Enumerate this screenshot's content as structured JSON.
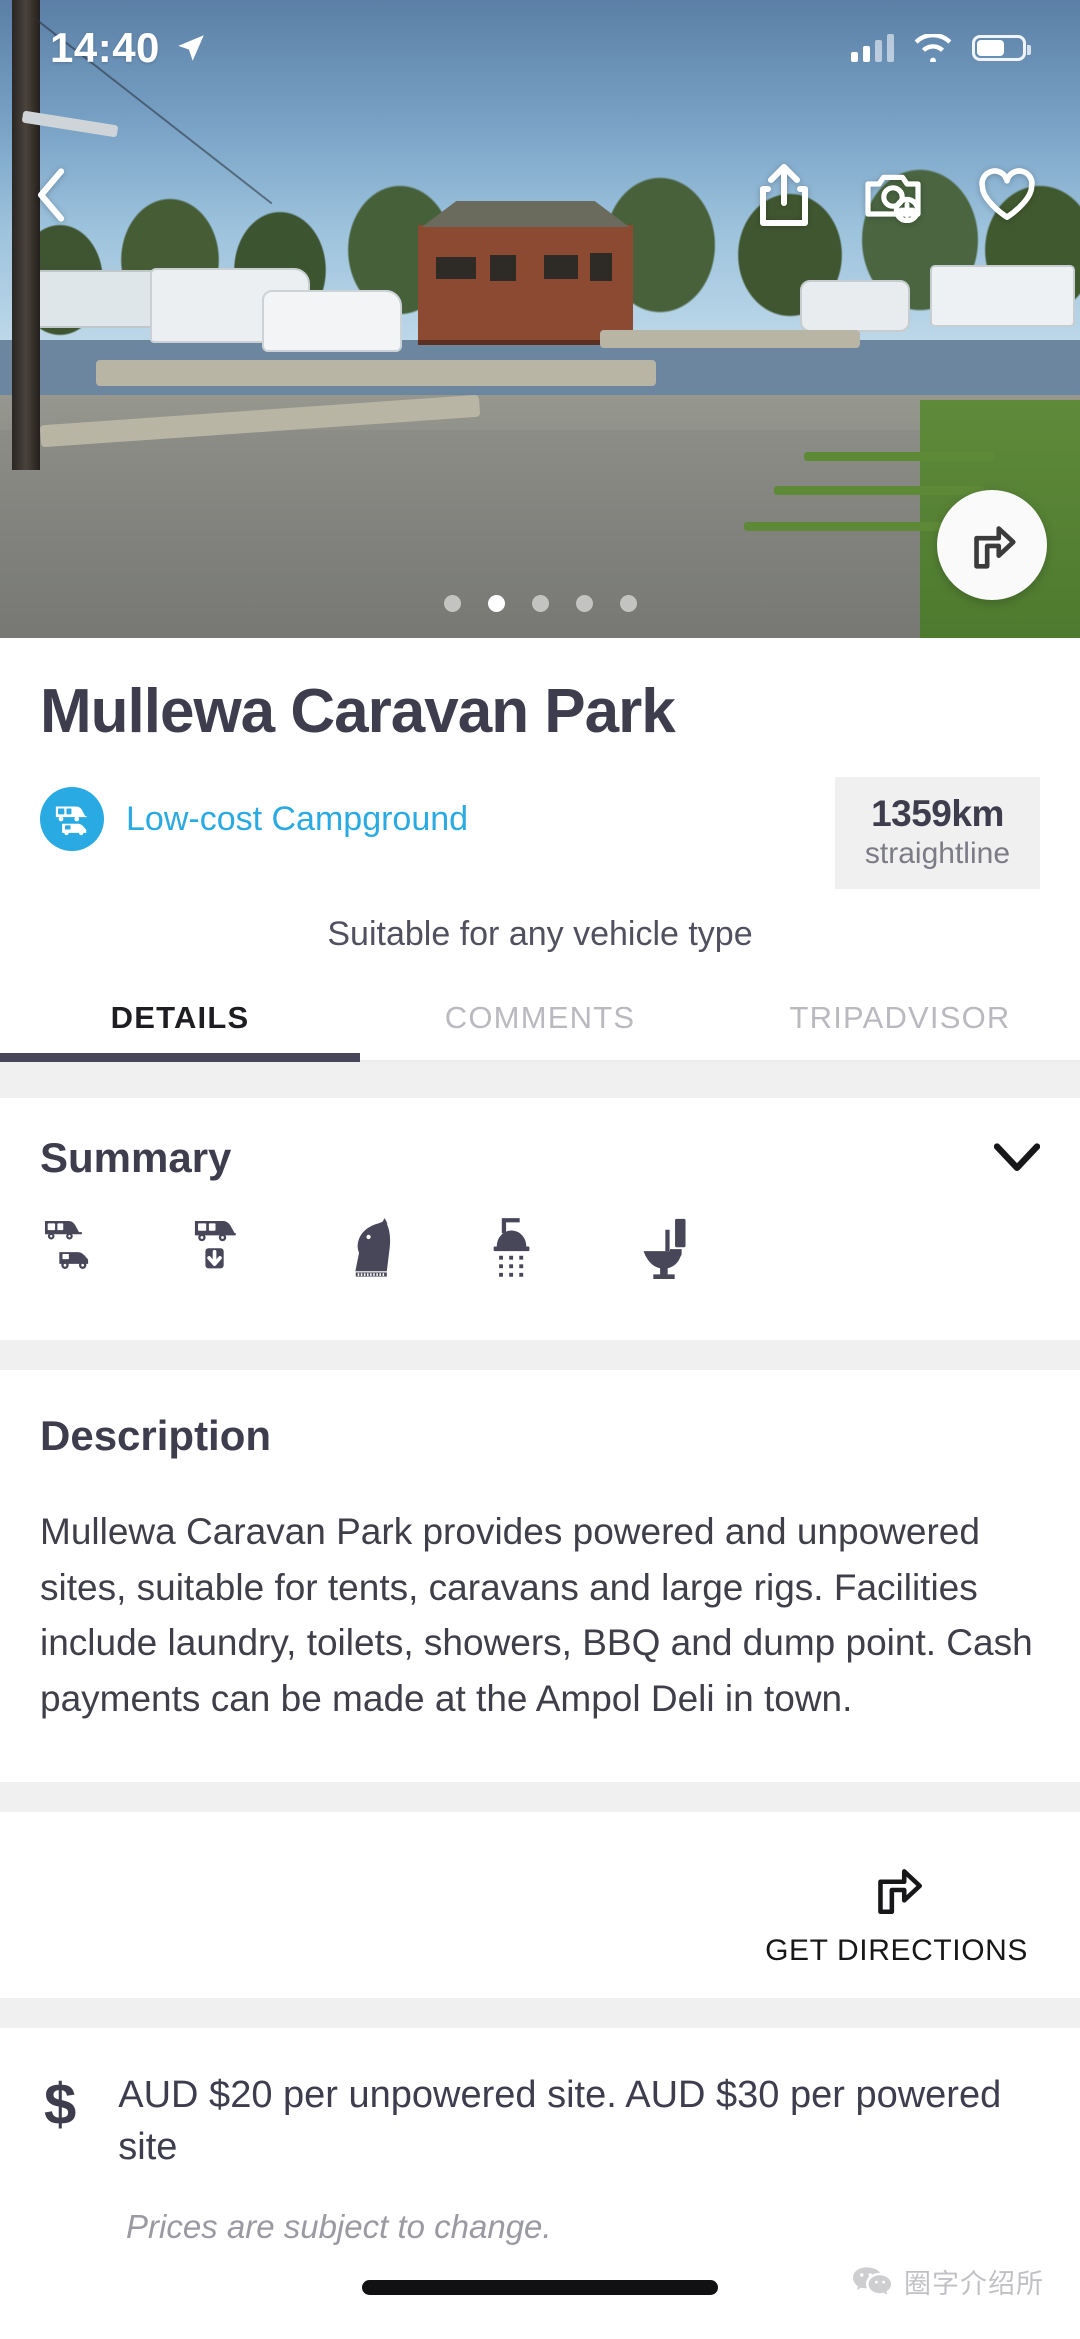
{
  "status_bar": {
    "time": "14:40",
    "location_icon": "location-arrow-icon",
    "cellular_icon": "cellular-signal-icon",
    "wifi_icon": "wifi-icon",
    "battery_icon": "battery-icon"
  },
  "hero": {
    "back_icon": "back-chevron-icon",
    "share_icon": "share-icon",
    "add_photo_icon": "camera-add-icon",
    "favourite_icon": "heart-icon",
    "directions_fab_icon": "turn-right-arrow-icon",
    "carousel": {
      "total": 5,
      "active_index": 1
    }
  },
  "place": {
    "title": "Mullewa Caravan Park",
    "category_icon": "caravan-car-icon",
    "category_label": "Low-cost Campground",
    "distance_value": "1359km",
    "distance_unit_label": "straightline",
    "vehicle_note": "Suitable for any vehicle type"
  },
  "tabs": [
    {
      "label": "DETAILS",
      "active": true
    },
    {
      "label": "COMMENTS",
      "active": false
    },
    {
      "label": "TRIPADVISOR",
      "active": false
    }
  ],
  "summary": {
    "title": "Summary",
    "collapse_icon": "chevron-down-icon",
    "amenities": [
      {
        "icon": "caravan-and-car-icon",
        "name": "Suitable for caravans and cars"
      },
      {
        "icon": "dump-point-icon",
        "name": "Dump point"
      },
      {
        "icon": "horse-icon",
        "name": "Horse friendly"
      },
      {
        "icon": "shower-icon",
        "name": "Showers"
      },
      {
        "icon": "toilet-icon",
        "name": "Toilets"
      }
    ]
  },
  "description": {
    "title": "Description",
    "body": "Mullewa Caravan Park provides powered and unpowered sites, suitable for tents, caravans and large rigs. Facilities include laundry, toilets, showers, BBQ and dump point. Cash payments can be made at the Ampol Deli in town."
  },
  "directions": {
    "icon": "turn-right-arrow-icon",
    "label": "GET DIRECTIONS"
  },
  "price": {
    "currency_icon": "dollar-sign-icon",
    "text": "AUD $20 per unpowered site. AUD $30 per powered site",
    "note": "Prices are subject to change."
  },
  "watermark": {
    "logo_icon": "wechat-logo-icon",
    "text": "圈字介绍所"
  },
  "colors": {
    "accent_blue": "#2aaae2",
    "text_dark": "#3d3d4e",
    "tab_active": "#474759",
    "divider_gray": "#f0f0f0",
    "muted_gray": "#b9b9bf"
  }
}
